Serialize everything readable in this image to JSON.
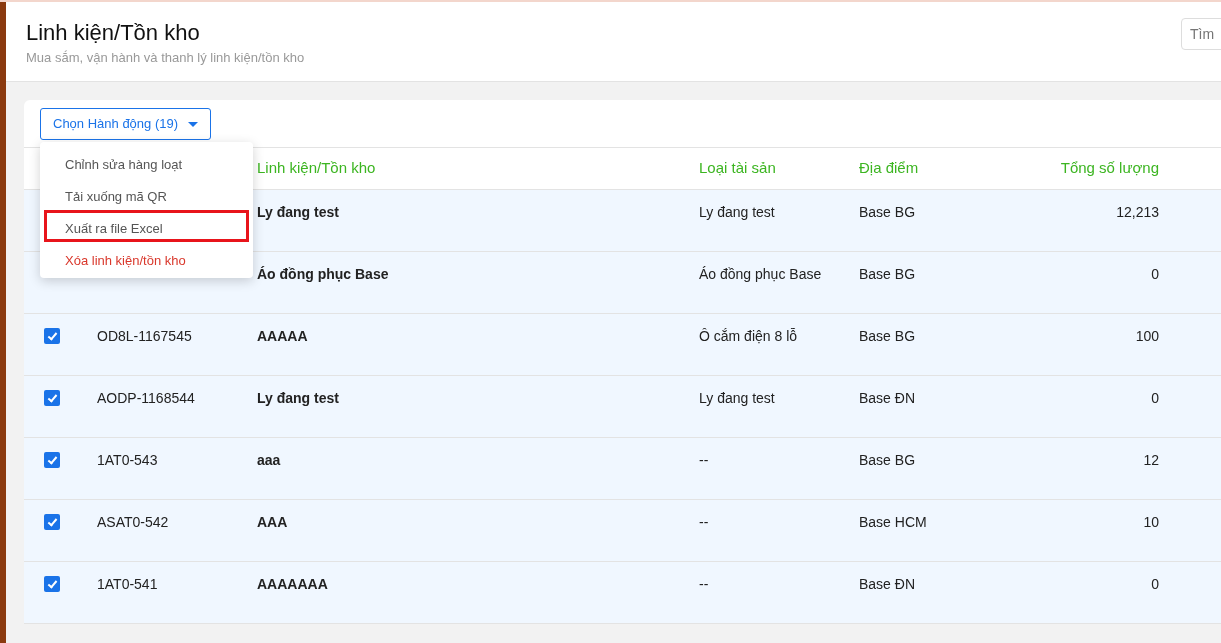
{
  "header": {
    "title": "Linh kiện/Tồn kho",
    "subtitle": "Mua sắm, vận hành và thanh lý linh kiện/tồn kho",
    "search": {
      "placeholder": "Tìm"
    }
  },
  "action_button": {
    "label": "Chọn Hành động (19)"
  },
  "action_menu": [
    {
      "label": "Chỉnh sửa hàng loạt",
      "kind": "normal",
      "highlighted": false
    },
    {
      "label": "Tải xuống mã QR",
      "kind": "normal",
      "highlighted": false
    },
    {
      "label": "Xuất ra file Excel",
      "kind": "normal",
      "highlighted": true
    },
    {
      "label": "Xóa linh kiện/tồn kho",
      "kind": "danger",
      "highlighted": false
    }
  ],
  "table": {
    "columns": [
      "Linh kiện/Tồn kho",
      "Loại tài sản",
      "Địa điểm",
      "Tổng số lượng"
    ],
    "rows": [
      {
        "name": "Ly đang test",
        "type": "Ly đang test",
        "location": "Base BG",
        "quantity": "12,213"
      },
      {
        "name": "Áo đồng phục Base",
        "type": "Áo đồng phục Base",
        "location": "Base BG",
        "quantity": "0"
      },
      {
        "checked": true,
        "code": "OD8L-1167545",
        "name": "AAAAA",
        "type": "Ô cắm điện 8 lỗ",
        "location": "Base BG",
        "quantity": "100"
      },
      {
        "checked": true,
        "code": "AODP-1168544",
        "name": "Ly đang test",
        "type": "Ly đang test",
        "location": "Base ĐN",
        "quantity": "0"
      },
      {
        "checked": true,
        "code": "1AT0-543",
        "name": "aaa",
        "type": "--",
        "location": "Base BG",
        "quantity": "12"
      },
      {
        "checked": true,
        "code": "ASAT0-542",
        "name": "AAA",
        "type": "--",
        "location": "Base HCM",
        "quantity": "10"
      },
      {
        "checked": true,
        "code": "1AT0-541",
        "name": "AAAAAAA",
        "type": "--",
        "location": "Base ĐN",
        "quantity": "0"
      }
    ]
  }
}
